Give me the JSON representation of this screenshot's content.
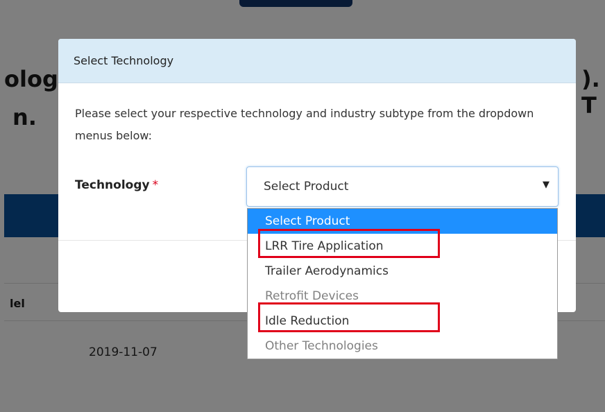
{
  "background": {
    "heading_line1_fragment": "olog",
    "heading_line2_fragment": "n.",
    "heading_right_fragment": "). T",
    "column_label_fragment": "lel",
    "date_cell": "2019-11-07"
  },
  "modal": {
    "title": "Select Technology",
    "description": "Please select your respective technology and industry subtype from the dropdown menus below:",
    "field_label": "Technology",
    "required_marker": "*"
  },
  "select": {
    "current_value": "Select Product",
    "arrow_icon": "triangle-down-icon"
  },
  "dropdown": {
    "options": [
      "Select Product",
      "LRR Tire Application",
      "Trailer Aerodynamics",
      "Retrofit Devices",
      "Idle Reduction",
      "Other Technologies"
    ],
    "selected_index": 0
  },
  "colors": {
    "highlight_box": "#e0001a",
    "selected_option_bg": "#1e90ff",
    "header_bg": "#d9ebf7",
    "blue_bar": "#08509b"
  }
}
